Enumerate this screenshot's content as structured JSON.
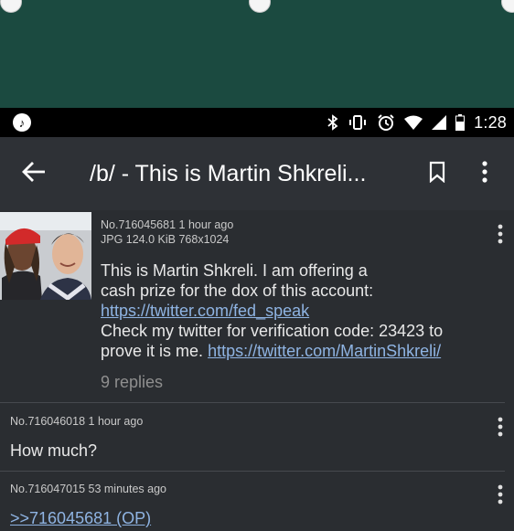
{
  "status_bar": {
    "time": "1:28"
  },
  "toolbar": {
    "title": "/b/ - This is Martin Shkreli..."
  },
  "posts": [
    {
      "number": "No.716045681",
      "age": "1 hour ago",
      "file_info": "JPG 124.0 KiB 768x1024",
      "text_1": "This is Martin Shkreli. I am offering a",
      "text_2": "cash prize for the dox of this account:",
      "link_1": "https://twitter.com/fed_speak",
      "text_3": "Check my twitter for verification code: 23423 to",
      "text_4": "prove it is me.",
      "link_2": "https://twitter.com/MartinShkreli/",
      "replies": "9 replies"
    },
    {
      "number": "No.716046018",
      "age": "1 hour ago",
      "comment": "How much?"
    },
    {
      "number": "No.716047015",
      "age": "53 minutes ago",
      "quote_link": ">>716045681 (OP)"
    }
  ]
}
